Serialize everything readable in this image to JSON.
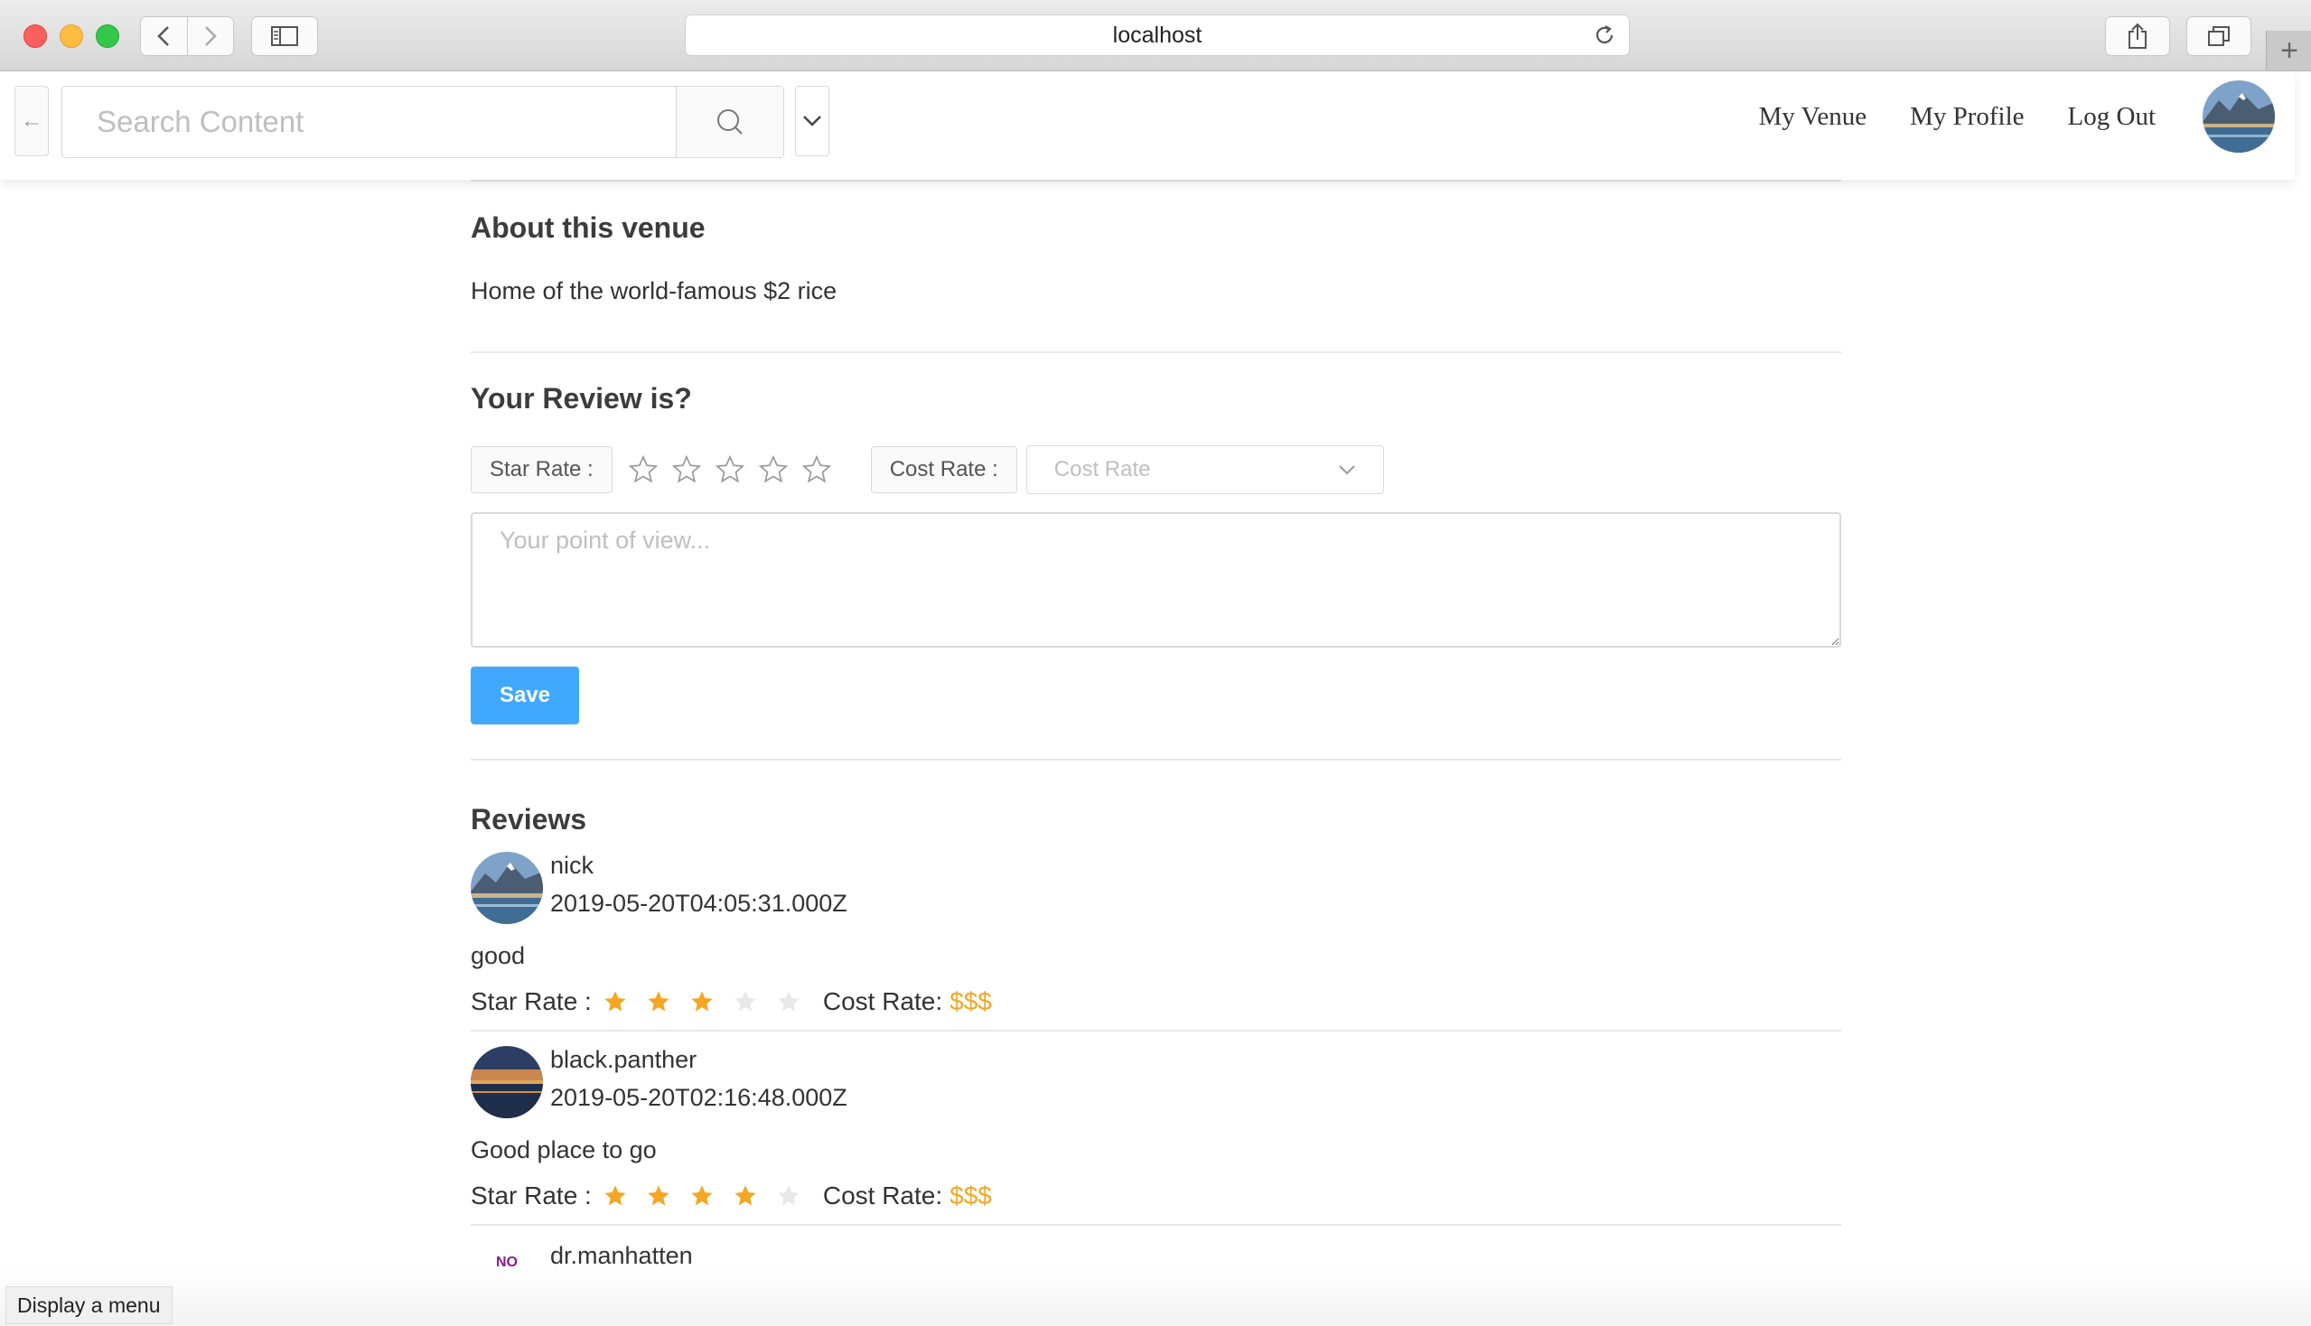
{
  "browser": {
    "url": "localhost",
    "icons": [
      "back-arrow-icon",
      "forward-arrow-icon",
      "sidebar-icon",
      "reload-icon",
      "share-icon",
      "tabs-icon",
      "plus-icon"
    ]
  },
  "header": {
    "search_placeholder": "Search Content",
    "back_icon": "←",
    "nav": {
      "my_venue": "My Venue",
      "my_profile": "My Profile",
      "log_out": "Log Out"
    }
  },
  "about": {
    "title": "About this venue",
    "description": "Home of the world-famous $2 rice"
  },
  "review_form": {
    "title": "Your Review is?",
    "star_rate_label": "Star Rate :",
    "star_rate_value": 0,
    "star_max": 5,
    "cost_rate_label": "Cost Rate :",
    "cost_rate_placeholder": "Cost Rate",
    "textarea_placeholder": "Your point of view...",
    "save_label": "Save"
  },
  "reviews": {
    "title": "Reviews",
    "star_label": "Star Rate :",
    "cost_label": "Cost Rate:",
    "items": [
      {
        "name": "nick",
        "date": "2019-05-20T04:05:31.000Z",
        "text": "good",
        "stars": 3,
        "cost": "$$$",
        "avatar": "mountain-lake"
      },
      {
        "name": "black.panther",
        "date": "2019-05-20T02:16:48.000Z",
        "text": "Good place to go",
        "stars": 4,
        "cost": "$$$",
        "avatar": "sunset-lake"
      },
      {
        "name": "dr.manhatten",
        "avatar_text": "NO"
      }
    ]
  },
  "tooltip": "Display a menu",
  "colors": {
    "accent": "#40a9ff",
    "star": "#f5a623",
    "cost": "#f5a623"
  }
}
